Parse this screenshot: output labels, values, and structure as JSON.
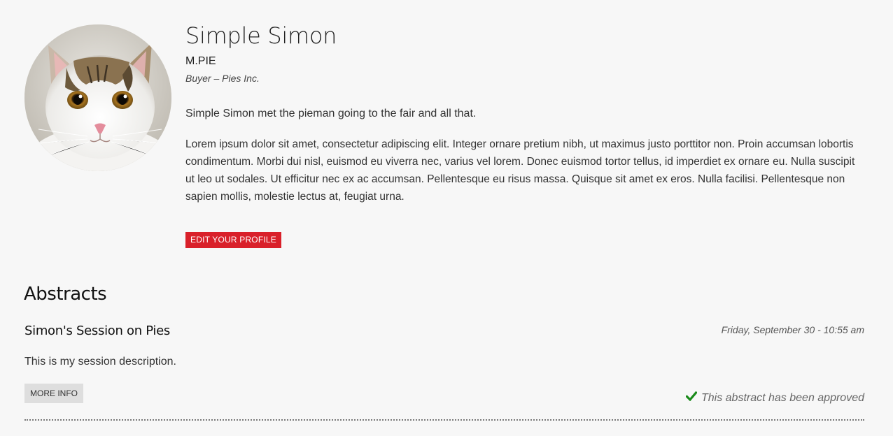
{
  "profile": {
    "avatar_icon": "cat-photo",
    "name": "Simple Simon",
    "handle": "M.PIE",
    "role": "Buyer – Pies Inc.",
    "tagline": "Simple Simon met the pieman going to the fair and all that.",
    "bio": "Lorem ipsum dolor sit amet, consectetur adipiscing elit. Integer ornare pretium nibh, ut maximus justo porttitor non. Proin accumsan lobortis condimentum. Morbi dui nisl, euismod eu viverra nec, varius vel lorem. Donec euismod tortor tellus, id imperdiet ex ornare eu. Nulla suscipit ut leo ut sodales. Ut efficitur nec ex ac accumsan. Pellentesque eu risus massa. Quisque sit amet ex eros. Nulla facilisi. Pellentesque non sapien mollis, molestie lectus at, feugiat urna.",
    "edit_button_label": "EDIT YOUR PROFILE",
    "edit_button_color": "#d9202a"
  },
  "abstracts": {
    "heading": "Abstracts",
    "items": [
      {
        "title": "Simon's Session on Pies",
        "date": "Friday, September 30 - 10:55 am",
        "description": "This is my session description.",
        "more_info_label": "MORE INFO",
        "status_icon": "check-icon",
        "status_color": "#1a8a1a",
        "status_text": "This abstract has been approved"
      }
    ]
  }
}
